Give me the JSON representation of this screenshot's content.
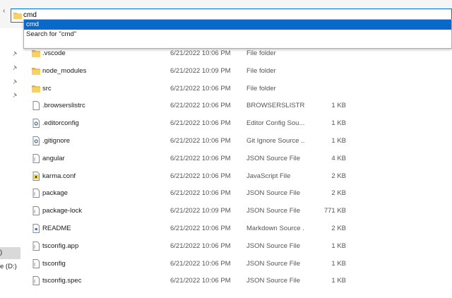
{
  "address": {
    "text": "cmd"
  },
  "suggestions": [
    {
      "label": "cmd",
      "selected": true
    },
    {
      "label": "Search for \"cmd\"",
      "selected": false
    }
  ],
  "nav": {
    "labels": [
      ")",
      "e (D:)"
    ]
  },
  "files": [
    {
      "name": ".vscode",
      "date": "6/21/2022 10:06 PM",
      "type": "File folder",
      "size": "",
      "icon": "folder-icon"
    },
    {
      "name": "node_modules",
      "date": "6/21/2022 10:09 PM",
      "type": "File folder",
      "size": "",
      "icon": "folder-icon"
    },
    {
      "name": "src",
      "date": "6/21/2022 10:06 PM",
      "type": "File folder",
      "size": "",
      "icon": "folder-icon"
    },
    {
      "name": ".browserslistrc",
      "date": "6/21/2022 10:06 PM",
      "type": "BROWSERSLISTRC ...",
      "size": "1 KB",
      "icon": "file-icon"
    },
    {
      "name": ".editorconfig",
      "date": "6/21/2022 10:06 PM",
      "type": "Editor Config Sou...",
      "size": "1 KB",
      "icon": "config-file-icon"
    },
    {
      "name": ".gitignore",
      "date": "6/21/2022 10:06 PM",
      "type": "Git Ignore Source ...",
      "size": "1 KB",
      "icon": "config-file-icon"
    },
    {
      "name": "angular",
      "date": "6/21/2022 10:06 PM",
      "type": "JSON Source File",
      "size": "4 KB",
      "icon": "json-file-icon"
    },
    {
      "name": "karma.conf",
      "date": "6/21/2022 10:06 PM",
      "type": "JavaScript File",
      "size": "2 KB",
      "icon": "js-file-icon"
    },
    {
      "name": "package",
      "date": "6/21/2022 10:06 PM",
      "type": "JSON Source File",
      "size": "2 KB",
      "icon": "json-file-icon"
    },
    {
      "name": "package-lock",
      "date": "6/21/2022 10:09 PM",
      "type": "JSON Source File",
      "size": "771 KB",
      "icon": "json-file-icon"
    },
    {
      "name": "README",
      "date": "6/21/2022 10:06 PM",
      "type": "Markdown Source ...",
      "size": "2 KB",
      "icon": "markdown-file-icon"
    },
    {
      "name": "tsconfig.app",
      "date": "6/21/2022 10:06 PM",
      "type": "JSON Source File",
      "size": "1 KB",
      "icon": "json-file-icon"
    },
    {
      "name": "tsconfig",
      "date": "6/21/2022 10:06 PM",
      "type": "JSON Source File",
      "size": "1 KB",
      "icon": "json-file-icon"
    },
    {
      "name": "tsconfig.spec",
      "date": "6/21/2022 10:06 PM",
      "type": "JSON Source File",
      "size": "1 KB",
      "icon": "json-file-icon"
    }
  ],
  "colors": {
    "accent": "#0a68c8",
    "folder": "#f0c24a",
    "selectedNav": "#d9d9d9"
  }
}
